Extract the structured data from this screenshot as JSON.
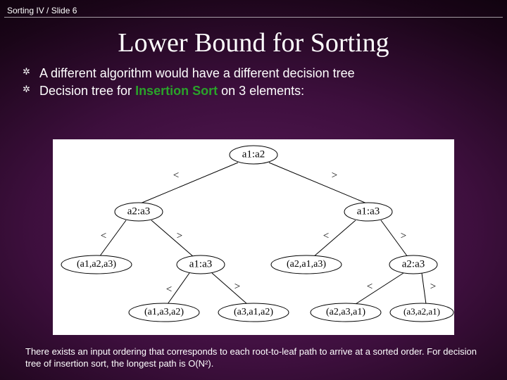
{
  "header": {
    "breadcrumb": "Sorting IV / Slide 6"
  },
  "title": "Lower Bound for Sorting",
  "bullets": {
    "b1": "A different algorithm would have a different decision tree",
    "b2_a": "Decision tree for ",
    "b2_b": "Insertion Sort",
    "b2_c": " on 3 elements:"
  },
  "footer": "There exists an input ordering that corresponds to each root-to-leaf path to arrive at a sorted order.  For decision tree of insertion sort, the longest path is O(N²).",
  "tree": {
    "n_root": "a1:a2",
    "n_L": "a2:a3",
    "n_R": "a1:a3",
    "n_LL": "(a1,a2,a3)",
    "n_LR": "a1:a3",
    "n_RL": "(a2,a1,a3)",
    "n_RR": "a2:a3",
    "n_LRL": "(a1,a3,a2)",
    "n_LRR": "(a3,a1,a2)",
    "n_RRL": "(a2,a3,a1)",
    "n_RRR": "(a3,a2,a1)",
    "lt": "<",
    "gt": ">"
  }
}
